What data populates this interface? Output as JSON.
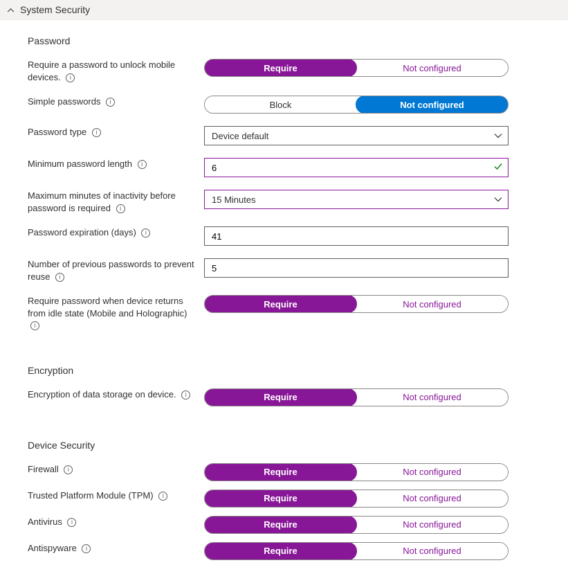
{
  "section": {
    "title": "System Security"
  },
  "groups": {
    "password": {
      "heading": "Password",
      "require_unlock": {
        "label": "Require a password to unlock mobile devices.",
        "opt1": "Require",
        "opt2": "Not configured"
      },
      "simple_passwords": {
        "label": "Simple passwords",
        "opt1": "Block",
        "opt2": "Not configured"
      },
      "password_type": {
        "label": "Password type",
        "value": "Device default"
      },
      "min_length": {
        "label": "Minimum password length",
        "value": "6"
      },
      "max_inactivity": {
        "label": "Maximum minutes of inactivity before password is required",
        "value": "15 Minutes"
      },
      "expiration": {
        "label": "Password expiration (days)",
        "value": "41"
      },
      "previous_passwords": {
        "label": "Number of previous passwords to prevent reuse",
        "value": "5"
      },
      "require_idle": {
        "label": "Require password when device returns from idle state (Mobile and Holographic)",
        "opt1": "Require",
        "opt2": "Not configured"
      }
    },
    "encryption": {
      "heading": "Encryption",
      "data_storage": {
        "label": "Encryption of data storage on device.",
        "opt1": "Require",
        "opt2": "Not configured"
      }
    },
    "device_security": {
      "heading": "Device Security",
      "firewall": {
        "label": "Firewall",
        "opt1": "Require",
        "opt2": "Not configured"
      },
      "tpm": {
        "label": "Trusted Platform Module (TPM)",
        "opt1": "Require",
        "opt2": "Not configured"
      },
      "antivirus": {
        "label": "Antivirus",
        "opt1": "Require",
        "opt2": "Not configured"
      },
      "antispyware": {
        "label": "Antispyware",
        "opt1": "Require",
        "opt2": "Not configured"
      }
    }
  }
}
